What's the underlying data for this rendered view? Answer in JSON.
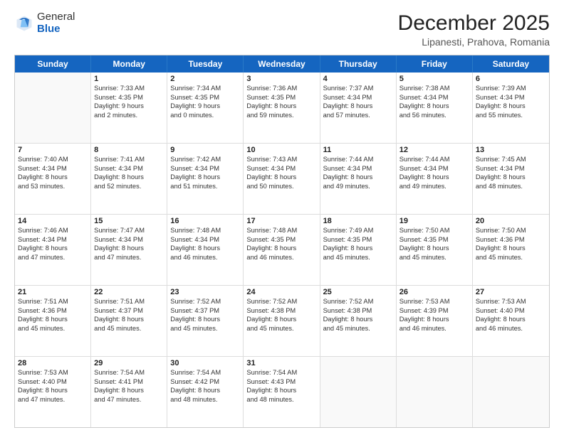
{
  "logo": {
    "general": "General",
    "blue": "Blue"
  },
  "header": {
    "title": "December 2025",
    "subtitle": "Lipanesti, Prahova, Romania"
  },
  "weekdays": [
    "Sunday",
    "Monday",
    "Tuesday",
    "Wednesday",
    "Thursday",
    "Friday",
    "Saturday"
  ],
  "weeks": [
    [
      {
        "day": "",
        "lines": []
      },
      {
        "day": "1",
        "lines": [
          "Sunrise: 7:33 AM",
          "Sunset: 4:35 PM",
          "Daylight: 9 hours",
          "and 2 minutes."
        ]
      },
      {
        "day": "2",
        "lines": [
          "Sunrise: 7:34 AM",
          "Sunset: 4:35 PM",
          "Daylight: 9 hours",
          "and 0 minutes."
        ]
      },
      {
        "day": "3",
        "lines": [
          "Sunrise: 7:36 AM",
          "Sunset: 4:35 PM",
          "Daylight: 8 hours",
          "and 59 minutes."
        ]
      },
      {
        "day": "4",
        "lines": [
          "Sunrise: 7:37 AM",
          "Sunset: 4:34 PM",
          "Daylight: 8 hours",
          "and 57 minutes."
        ]
      },
      {
        "day": "5",
        "lines": [
          "Sunrise: 7:38 AM",
          "Sunset: 4:34 PM",
          "Daylight: 8 hours",
          "and 56 minutes."
        ]
      },
      {
        "day": "6",
        "lines": [
          "Sunrise: 7:39 AM",
          "Sunset: 4:34 PM",
          "Daylight: 8 hours",
          "and 55 minutes."
        ]
      }
    ],
    [
      {
        "day": "7",
        "lines": [
          "Sunrise: 7:40 AM",
          "Sunset: 4:34 PM",
          "Daylight: 8 hours",
          "and 53 minutes."
        ]
      },
      {
        "day": "8",
        "lines": [
          "Sunrise: 7:41 AM",
          "Sunset: 4:34 PM",
          "Daylight: 8 hours",
          "and 52 minutes."
        ]
      },
      {
        "day": "9",
        "lines": [
          "Sunrise: 7:42 AM",
          "Sunset: 4:34 PM",
          "Daylight: 8 hours",
          "and 51 minutes."
        ]
      },
      {
        "day": "10",
        "lines": [
          "Sunrise: 7:43 AM",
          "Sunset: 4:34 PM",
          "Daylight: 8 hours",
          "and 50 minutes."
        ]
      },
      {
        "day": "11",
        "lines": [
          "Sunrise: 7:44 AM",
          "Sunset: 4:34 PM",
          "Daylight: 8 hours",
          "and 49 minutes."
        ]
      },
      {
        "day": "12",
        "lines": [
          "Sunrise: 7:44 AM",
          "Sunset: 4:34 PM",
          "Daylight: 8 hours",
          "and 49 minutes."
        ]
      },
      {
        "day": "13",
        "lines": [
          "Sunrise: 7:45 AM",
          "Sunset: 4:34 PM",
          "Daylight: 8 hours",
          "and 48 minutes."
        ]
      }
    ],
    [
      {
        "day": "14",
        "lines": [
          "Sunrise: 7:46 AM",
          "Sunset: 4:34 PM",
          "Daylight: 8 hours",
          "and 47 minutes."
        ]
      },
      {
        "day": "15",
        "lines": [
          "Sunrise: 7:47 AM",
          "Sunset: 4:34 PM",
          "Daylight: 8 hours",
          "and 47 minutes."
        ]
      },
      {
        "day": "16",
        "lines": [
          "Sunrise: 7:48 AM",
          "Sunset: 4:34 PM",
          "Daylight: 8 hours",
          "and 46 minutes."
        ]
      },
      {
        "day": "17",
        "lines": [
          "Sunrise: 7:48 AM",
          "Sunset: 4:35 PM",
          "Daylight: 8 hours",
          "and 46 minutes."
        ]
      },
      {
        "day": "18",
        "lines": [
          "Sunrise: 7:49 AM",
          "Sunset: 4:35 PM",
          "Daylight: 8 hours",
          "and 45 minutes."
        ]
      },
      {
        "day": "19",
        "lines": [
          "Sunrise: 7:50 AM",
          "Sunset: 4:35 PM",
          "Daylight: 8 hours",
          "and 45 minutes."
        ]
      },
      {
        "day": "20",
        "lines": [
          "Sunrise: 7:50 AM",
          "Sunset: 4:36 PM",
          "Daylight: 8 hours",
          "and 45 minutes."
        ]
      }
    ],
    [
      {
        "day": "21",
        "lines": [
          "Sunrise: 7:51 AM",
          "Sunset: 4:36 PM",
          "Daylight: 8 hours",
          "and 45 minutes."
        ]
      },
      {
        "day": "22",
        "lines": [
          "Sunrise: 7:51 AM",
          "Sunset: 4:37 PM",
          "Daylight: 8 hours",
          "and 45 minutes."
        ]
      },
      {
        "day": "23",
        "lines": [
          "Sunrise: 7:52 AM",
          "Sunset: 4:37 PM",
          "Daylight: 8 hours",
          "and 45 minutes."
        ]
      },
      {
        "day": "24",
        "lines": [
          "Sunrise: 7:52 AM",
          "Sunset: 4:38 PM",
          "Daylight: 8 hours",
          "and 45 minutes."
        ]
      },
      {
        "day": "25",
        "lines": [
          "Sunrise: 7:52 AM",
          "Sunset: 4:38 PM",
          "Daylight: 8 hours",
          "and 45 minutes."
        ]
      },
      {
        "day": "26",
        "lines": [
          "Sunrise: 7:53 AM",
          "Sunset: 4:39 PM",
          "Daylight: 8 hours",
          "and 46 minutes."
        ]
      },
      {
        "day": "27",
        "lines": [
          "Sunrise: 7:53 AM",
          "Sunset: 4:40 PM",
          "Daylight: 8 hours",
          "and 46 minutes."
        ]
      }
    ],
    [
      {
        "day": "28",
        "lines": [
          "Sunrise: 7:53 AM",
          "Sunset: 4:40 PM",
          "Daylight: 8 hours",
          "and 47 minutes."
        ]
      },
      {
        "day": "29",
        "lines": [
          "Sunrise: 7:54 AM",
          "Sunset: 4:41 PM",
          "Daylight: 8 hours",
          "and 47 minutes."
        ]
      },
      {
        "day": "30",
        "lines": [
          "Sunrise: 7:54 AM",
          "Sunset: 4:42 PM",
          "Daylight: 8 hours",
          "and 48 minutes."
        ]
      },
      {
        "day": "31",
        "lines": [
          "Sunrise: 7:54 AM",
          "Sunset: 4:43 PM",
          "Daylight: 8 hours",
          "and 48 minutes."
        ]
      },
      {
        "day": "",
        "lines": []
      },
      {
        "day": "",
        "lines": []
      },
      {
        "day": "",
        "lines": []
      }
    ]
  ]
}
